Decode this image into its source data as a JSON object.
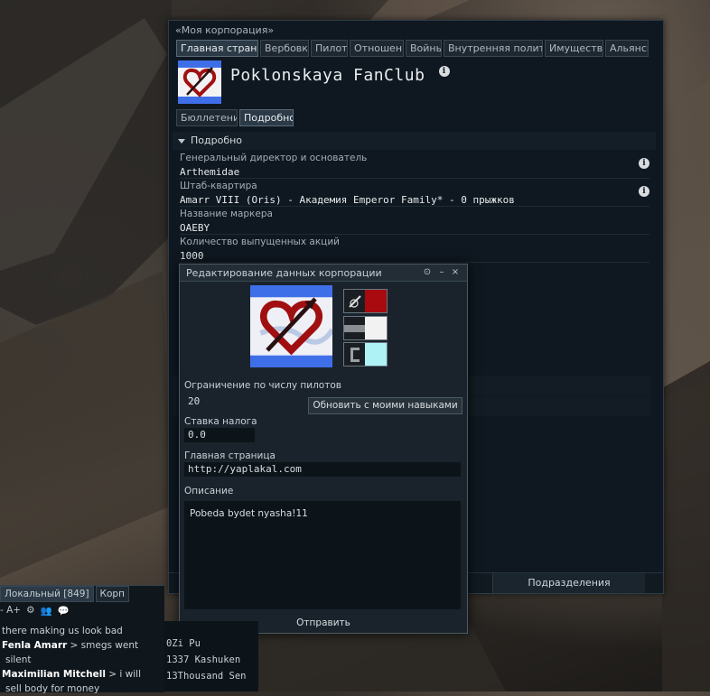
{
  "corp_window": {
    "caption": "«Моя корпорация»",
    "tabs": [
      "Главная страни",
      "Вербовк",
      "Пилоты",
      "Отношени",
      "Войны",
      "Внутренняя полити",
      "Имуществ",
      "Альянсы"
    ],
    "corp_name": "Poklonskaya FanClub",
    "subtabs": [
      "Бюллетени",
      "Подробно"
    ],
    "section_title": "Подробно",
    "fields": [
      {
        "label": "Генеральный директор и основатель",
        "value": "Arthemidae"
      },
      {
        "label": "Штаб-квартира",
        "value": "Amarr VIII (Oris) - Академия Emperor Family* - 0 прыжков"
      },
      {
        "label": "Название маркера",
        "value": "OAEBY"
      },
      {
        "label": "Количество выпущенных акций",
        "value": "1000"
      }
    ],
    "divisions_button": "Подразделения"
  },
  "edit_dialog": {
    "title": "Редактирование данных корпорации",
    "member_limit_label": "Ограничение по числу пилотов",
    "member_limit_value": "20",
    "update_skills_button": "Обновить с моими навыками",
    "tax_label": "Ставка налога",
    "tax_value": "0.0",
    "homepage_label": "Главная страница",
    "homepage_value": "http://yaplakal.com",
    "description_label": "Описание",
    "description_value": "Pobeda bydet nyasha!11",
    "submit_button": "Отправить"
  },
  "chat": {
    "tabs": [
      "Локальный [849]",
      "Корп"
    ],
    "font_controls": "- A+",
    "messages": [
      {
        "sender": "",
        "text": "there making us look bad"
      },
      {
        "sender": "Fenla Amarr",
        "text": " > smegs went"
      },
      {
        "sender": "",
        "text": "silent"
      },
      {
        "sender": "Maximilian Mitchell",
        "text": " > i will"
      },
      {
        "sender": "",
        "text": "sell body for money"
      }
    ]
  },
  "members": [
    "0Zi Pu",
    "1337 Kashuken",
    "13Thousand Sen"
  ],
  "colors": {
    "window_bg": "#0f1820",
    "accent_red": "#a01010",
    "logo_blue": "#4a7fff"
  }
}
